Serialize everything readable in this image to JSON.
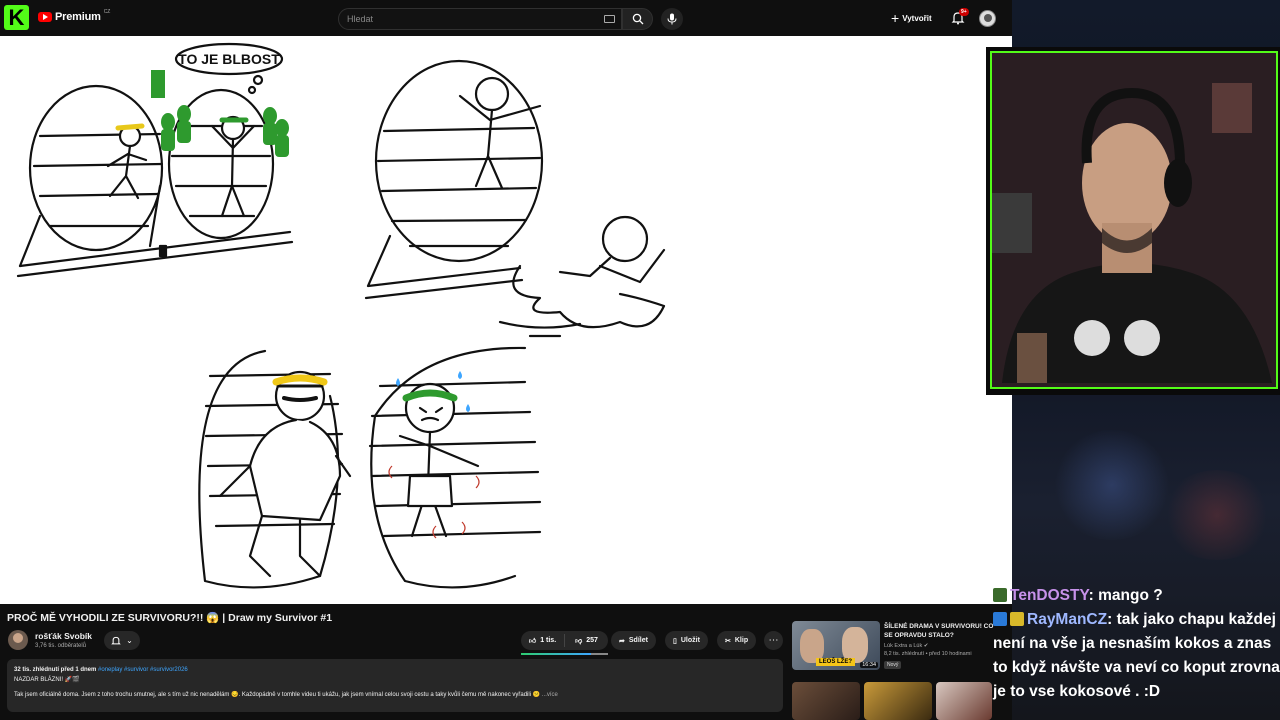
{
  "topbar": {
    "kick_logo": "K",
    "youtube_brand": "Premium",
    "region": "CZ",
    "search_placeholder": "Hledat",
    "create_label": "Vytvořit",
    "notifications_count": "9+",
    "icons": [
      "kick-logo",
      "youtube-logo",
      "keyboard-icon",
      "search-icon",
      "mic-icon",
      "plus-icon",
      "bell-icon",
      "account-avatar"
    ]
  },
  "video": {
    "speech_bubble": "TO JE BLBOST"
  },
  "meta": {
    "title": "PROČ MĚ VYHODILI ZE SURVIVORU?!! 😱 | Draw my Survivor #1",
    "channel_name": "rošťák Svobík",
    "subscribers": "3,76 tis. odběratelů",
    "likes": "1 tis.",
    "dislikes": "257",
    "like_ratio": 0.8,
    "share_label": "Sdílet",
    "save_label": "Uložit",
    "clip_label": "Klip",
    "more_label": "⋯"
  },
  "description": {
    "stats": "32 tis. zhlédnutí  před 1 dnem",
    "tags": "#oneplay #survivor #survivor2026",
    "line2": "NAZDAR BLÁZNI! 🚀🎬",
    "line3": "Tak jsem oficiálně doma. Jsem z toho trochu smutnej, ale s tím už nic nenadělám 😔. Každopádně v tomhle videu ti ukážu, jak jsem vnímal celou svoji cestu a taky kvůli čemu mě nakonec vyřadili 😕",
    "more": " ...více"
  },
  "recommendation": {
    "title": "ŠÍLENÉ DRAMA V SURVIVORU! CO SE OPRAVDU STALO?",
    "channel": "Lúk Extra a Lúk ✔",
    "meta": "8,2 tis. zhlédnutí • před 10 hodinami",
    "badge": "Nový",
    "duration": "16:34",
    "thumb_label": "LEOŠ LŽE?"
  },
  "chat": [
    {
      "user": "TenDOSTY",
      "text": ": mango ?"
    },
    {
      "user": "RayManCZ",
      "text": ": tak jako chapu každej není na vše ja nesnaším kokos a znas to když návšte va neví co koput zrovna je to vse kokosové . :D"
    }
  ],
  "colors": {
    "kick_green": "#53fc18",
    "youtube_red": "#ff0000",
    "link_blue": "#3ea6ff",
    "chat_user1": "#c792ea",
    "chat_user2": "#9fb8ff"
  }
}
